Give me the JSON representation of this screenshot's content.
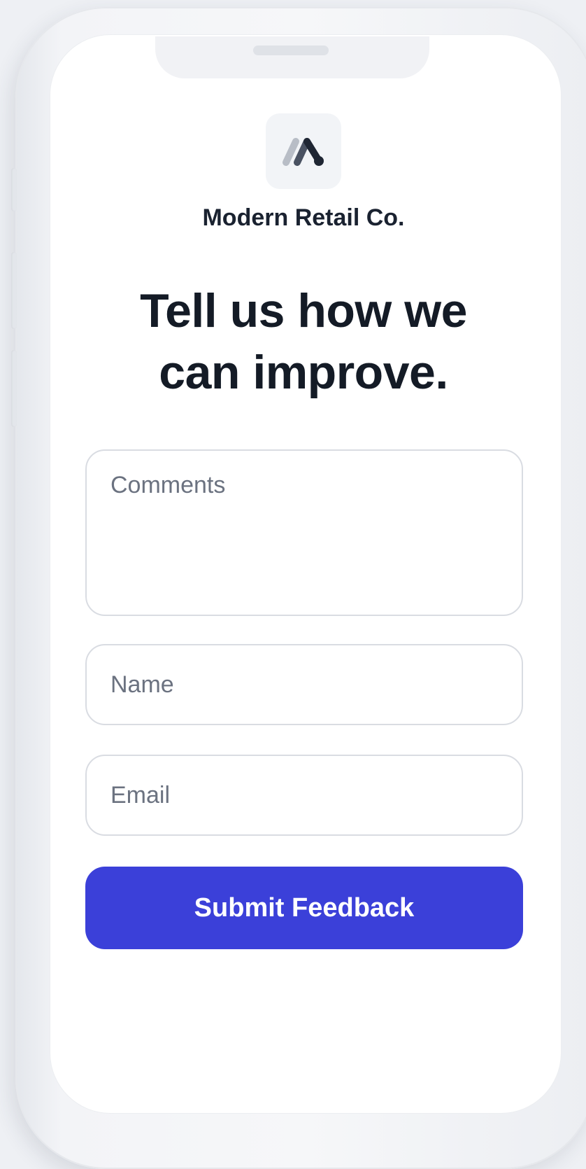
{
  "brand": {
    "logo_icon": "brand-logo-icon",
    "name": "Modern Retail Co."
  },
  "headline": "Tell us how we can improve.",
  "form": {
    "comments_placeholder": "Comments",
    "comments_value": "",
    "name_placeholder": "Name",
    "name_value": "",
    "email_placeholder": "Email",
    "email_value": "",
    "submit_label": "Submit Feedback"
  },
  "colors": {
    "primary": "#3b40d9",
    "text": "#141b26",
    "placeholder": "#6b7280",
    "border": "#d9dce2"
  }
}
